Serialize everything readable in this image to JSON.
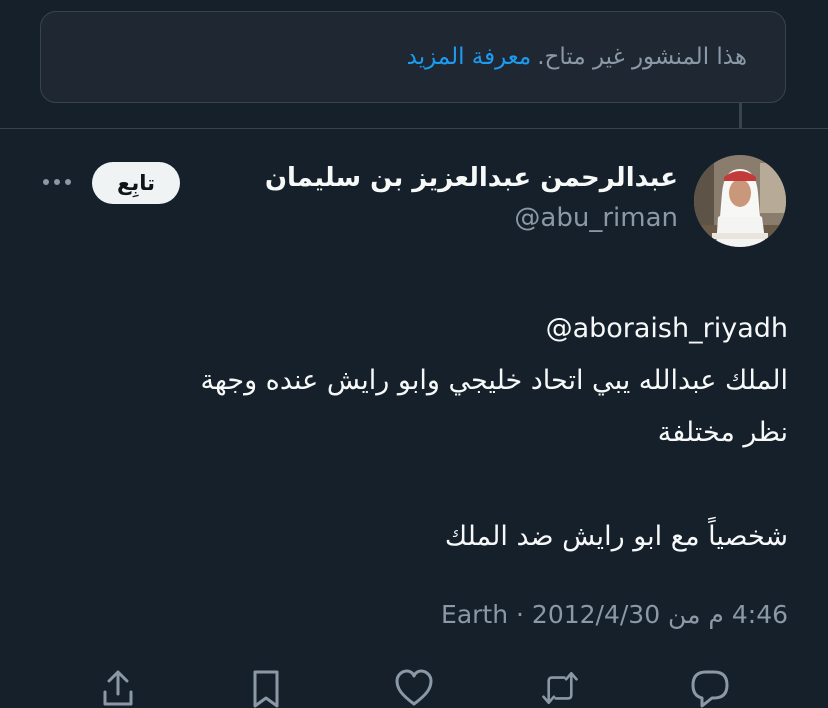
{
  "notice": {
    "message": "هذا المنشور غير متاح.",
    "link": "معرفة المزيد"
  },
  "tweet": {
    "author_name": "عبدالرحمن عبدالعزيز بن سليمان",
    "handle": "@abu_riman",
    "follow_label": "تابِع",
    "text_lines": [
      "aboraish_riyadh@",
      "الملك عبدالله يبي اتحاد خليجي وابو رايش عنده وجهة",
      "نظر مختلفة",
      "شخصياً مع ابو رايش ضد الملك"
    ],
    "meta": "4:46 م من Earth · 2012/4/30"
  },
  "icons": {
    "more": "more-horizontal-icon",
    "share": "share-icon",
    "bookmark": "bookmark-icon",
    "like": "heart-icon",
    "retweet": "retweet-icon",
    "reply": "reply-icon"
  },
  "colors": {
    "background": "#15202b",
    "link": "#1d9bf0",
    "secondary_text": "#8b98a5",
    "border": "#38444d"
  }
}
